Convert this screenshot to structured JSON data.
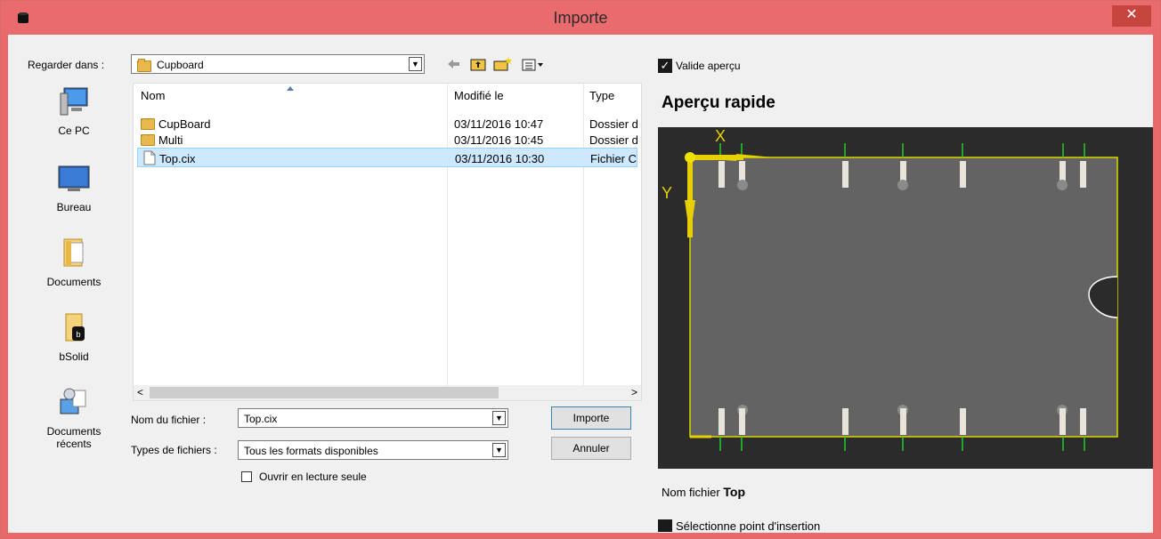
{
  "window": {
    "title": "Importe",
    "close_glyph": "✕"
  },
  "toolbar": {
    "look_in_label": "Regarder dans :",
    "look_in_value": "Cupboard",
    "icons": [
      "back-arrow-icon",
      "up-folder-icon",
      "new-folder-icon",
      "view-menu-icon"
    ]
  },
  "places": [
    {
      "label": "Ce PC"
    },
    {
      "label": "Bureau"
    },
    {
      "label": "Documents"
    },
    {
      "label": "bSolid"
    },
    {
      "label1": "Documents",
      "label2": "récents"
    }
  ],
  "file_list": {
    "columns": [
      "Nom",
      "Modifié le",
      "Type"
    ],
    "rows": [
      {
        "name": "CupBoard",
        "modified": "03/11/2016 10:47",
        "type": "Dossier d",
        "kind": "folder"
      },
      {
        "name": "Multi",
        "modified": "03/11/2016 10:45",
        "type": "Dossier d",
        "kind": "folder"
      },
      {
        "name": "Top.cix",
        "modified": "03/11/2016 10:30",
        "type": "Fichier C",
        "kind": "file",
        "selected": true
      }
    ],
    "scroll_left": "<",
    "scroll_right": ">"
  },
  "form": {
    "filename_label": "Nom du fichier :",
    "filename_value": "Top.cix",
    "filetype_label": "Types de fichiers :",
    "filetype_value": "Tous les formats disponibles",
    "readonly_label": "Ouvrir en lecture seule",
    "import_button": "Importe",
    "cancel_button": "Annuler"
  },
  "preview": {
    "valide_label": "Valide aperçu",
    "valide_check": "✓",
    "title": "Aperçu rapide",
    "axis_x": "X",
    "axis_y": "Y",
    "filename_label": "Nom fichier",
    "filename_value": "Top",
    "insertion_label": "Sélectionne point d'insertion",
    "colors": {
      "panel": "#636363",
      "outline": "#d8d800",
      "marker": "#22cc22",
      "background": "#2b2b2b"
    }
  }
}
